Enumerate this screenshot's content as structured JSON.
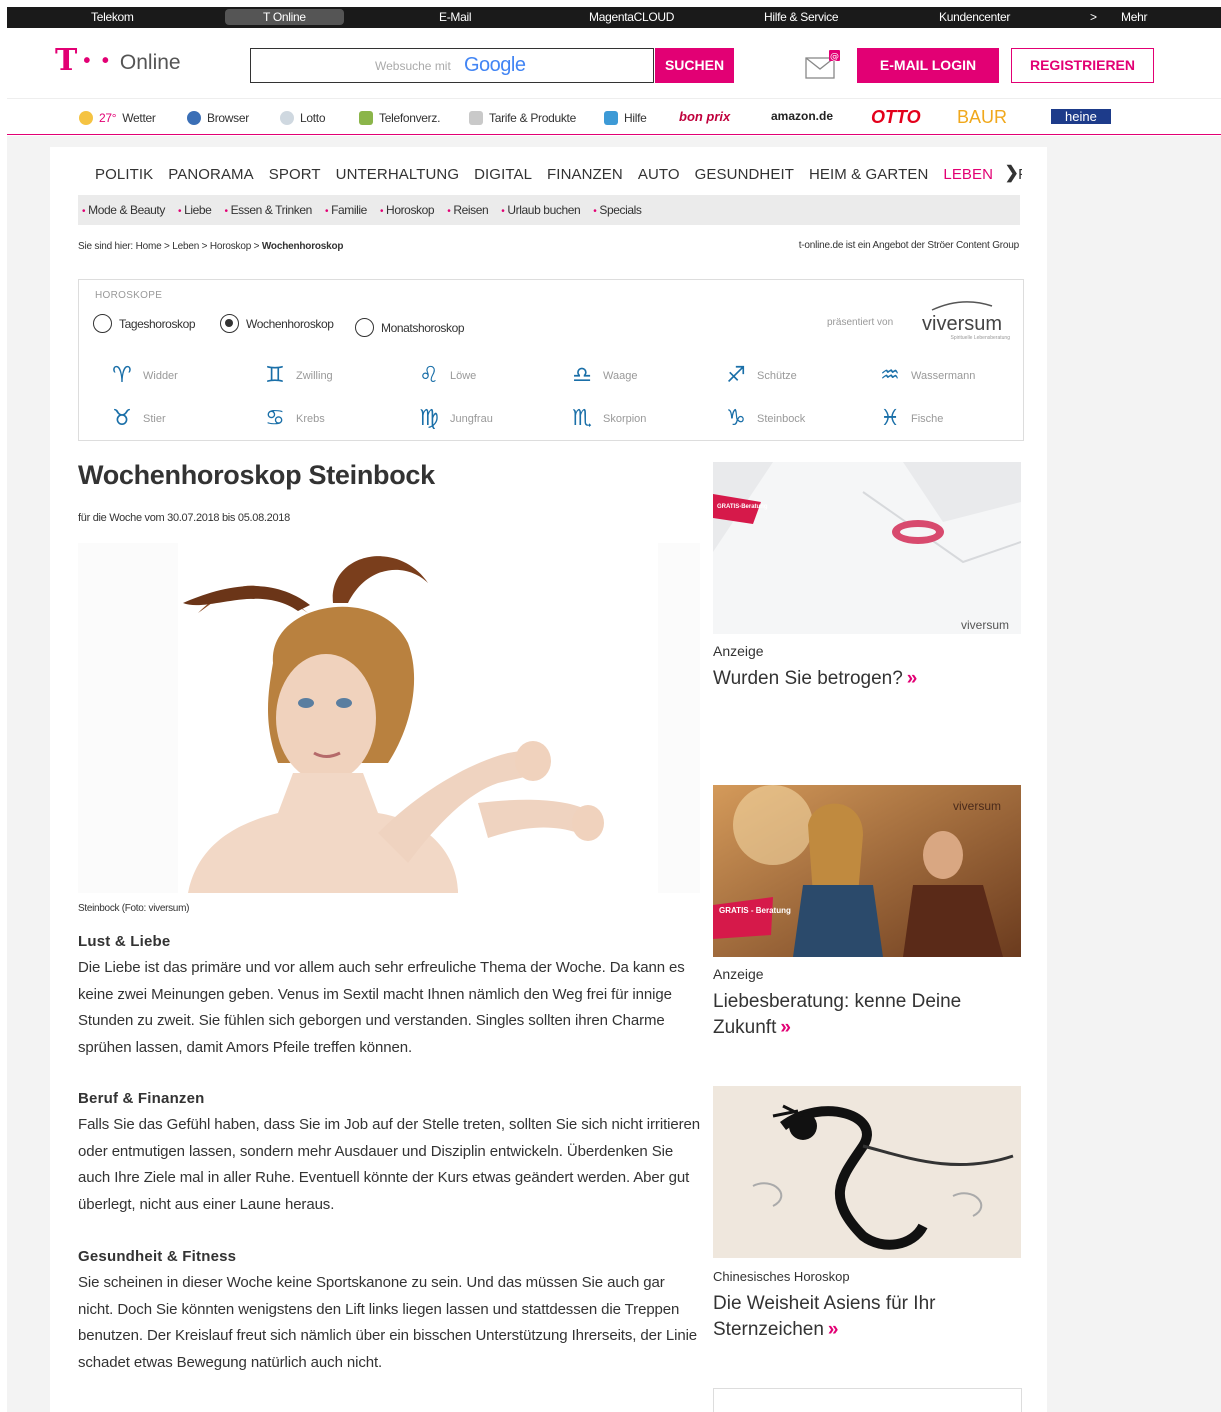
{
  "topbar": {
    "items": [
      "Telekom",
      "T Online",
      "E-Mail",
      "MagentaCLOUD",
      "Hilfe & Service",
      "Kundencenter",
      ">",
      "Mehr"
    ]
  },
  "header": {
    "logo_t": "T",
    "logo_dots": "• •",
    "logo_text": "Online",
    "search_placeholder": "Websuche mit",
    "search_google": "Google",
    "search_button": "SUCHEN",
    "login_button": "E-MAIL LOGIN",
    "register_button": "REGISTRIEREN",
    "accent_color": "#e20074"
  },
  "servicebar": {
    "weather_temp": "27°",
    "weather_label": "Wetter",
    "browser_label": "Browser",
    "lotto_label": "Lotto",
    "telefon_label": "Telefonverz.",
    "tarife_label": "Tarife & Produkte",
    "hilfe_label": "Hilfe",
    "bonprix": "bon prix",
    "amazon": "amazon.de",
    "otto": "OTTO",
    "baur": "BAUR",
    "heine": "heine"
  },
  "nav": {
    "items": [
      "POLITIK",
      "PANORAMA",
      "SPORT",
      "UNTERHALTUNG",
      "DIGITAL",
      "FINANZEN",
      "AUTO",
      "GESUNDHEIT",
      "HEIM & GARTEN",
      "LEBEN",
      "SPIELE"
    ],
    "active": "LEBEN",
    "more_arrow": "❯"
  },
  "subnav": {
    "items": [
      "Mode & Beauty",
      "Liebe",
      "Essen & Trinken",
      "Familie",
      "Horoskop",
      "Reisen",
      "Urlaub buchen",
      "Specials"
    ]
  },
  "breadcrumb": {
    "prefix": "Sie sind hier: Home > Leben > Horoskop >",
    "current": "Wochenhoroskop"
  },
  "provider_note": "t-online.de ist ein Angebot der Ströer Content Group",
  "horoscope_box": {
    "label": "HOROSKOPE",
    "options": [
      {
        "label": "Tageshoroskop",
        "selected": false
      },
      {
        "label": "Wochenhoroskop",
        "selected": true
      },
      {
        "label": "Monatshoroskop",
        "selected": false
      }
    ],
    "presented_by": "präsentiert von",
    "sponsor": "viversum",
    "sponsor_tagline": "Spirituelle Lebensberatung",
    "icon_color": "#1a6fa8",
    "signs": [
      {
        "name": "Widder",
        "glyph": "♈"
      },
      {
        "name": "Zwilling",
        "glyph": "♊"
      },
      {
        "name": "Löwe",
        "glyph": "♌"
      },
      {
        "name": "Waage",
        "glyph": "♎"
      },
      {
        "name": "Schütze",
        "glyph": "♐"
      },
      {
        "name": "Wassermann",
        "glyph": "♒"
      },
      {
        "name": "Stier",
        "glyph": "♉"
      },
      {
        "name": "Krebs",
        "glyph": "♋"
      },
      {
        "name": "Jungfrau",
        "glyph": "♍"
      },
      {
        "name": "Skorpion",
        "glyph": "♏"
      },
      {
        "name": "Steinbock",
        "glyph": "♑"
      },
      {
        "name": "Fische",
        "glyph": "♓"
      }
    ]
  },
  "article": {
    "title": "Wochenhoroskop Steinbock",
    "date": "für die Woche vom 30.07.2018 bis 05.08.2018",
    "caption": "Steinbock (Foto: viversum)",
    "sections": [
      {
        "heading": "Lust & Liebe",
        "text": "Die Liebe ist das primäre und vor allem auch sehr erfreuliche Thema der Woche. Da kann es keine zwei Meinungen geben. Venus im Sextil macht Ihnen nämlich den Weg frei für innige Stunden zu zweit. Sie fühlen sich geborgen und verstanden. Singles sollten ihren Charme sprühen lassen, damit Amors Pfeile treffen können."
      },
      {
        "heading": "Beruf & Finanzen",
        "text": "Falls Sie das Gefühl haben, dass Sie im Job auf der Stelle treten, sollten Sie sich nicht irritieren oder entmutigen lassen, sondern mehr Ausdauer und Disziplin entwickeln. Überdenken Sie auch Ihre Ziele mal in aller Ruhe. Eventuell könnte der Kurs etwas geändert werden. Aber gut überlegt, nicht aus einer Laune heraus."
      },
      {
        "heading": "Gesundheit & Fitness",
        "text": "Sie scheinen in dieser Woche keine Sportskanone zu sein. Und das müssen Sie auch gar nicht. Doch Sie könnten wenigstens den Lift links liegen lassen und stattdessen die Treppen benutzen. Der Kreislauf freut sich nämlich über ein bisschen Unterstützung Ihrerseits, der Linie schadet etwas Bewegung natürlich auch nicht."
      }
    ]
  },
  "sidebar": {
    "ads": [
      {
        "label": "Anzeige",
        "title": "Wurden Sie betrogen?",
        "badge": "GRATIS-Beratung",
        "brand": "viversum"
      },
      {
        "label": "Anzeige",
        "title": "Liebesberatung: kenne Deine Zukunft",
        "badge": "GRATIS - Beratung",
        "brand": "viversum"
      },
      {
        "label": "Chinesisches Horoskop",
        "title": "Die Weisheit Asiens für Ihr Sternzeichen"
      }
    ],
    "more_glyph": "»"
  }
}
